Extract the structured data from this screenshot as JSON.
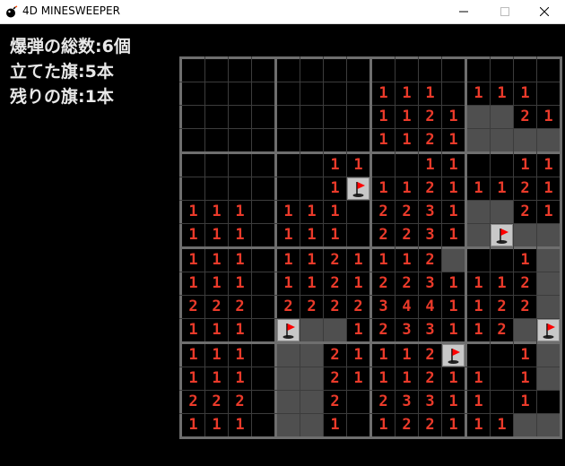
{
  "window": {
    "title": "4D MINESWEEPER",
    "minimize_glyph": "─",
    "maximize_glyph": "☐",
    "close_glyph": "✕"
  },
  "status": {
    "total_bombs": "爆弾の総数:6個",
    "flags_placed": "立てた旗:5本",
    "flags_left": "残りの旗:1本"
  },
  "colors": {
    "number": "#ea3a2a",
    "unopened": "#4f4f4f",
    "flag_cell": "#c8c8c8",
    "flag": "#ff0000"
  },
  "board": {
    "block_count": 4,
    "block_size": 4,
    "legend": "#=unopened, F=flag, -=opened empty, digits=count",
    "rows": [
      "----------------",
      "--------111-111-",
      "--------1121##21",
      "--------1121####",
      "------11--11--11",
      "------1F11211121",
      "111-111-2231##21",
      "111-111-2231#F##",
      "111-1121112#--1#",
      "111-11212231112#",
      "222-22223441122#",
      "111-F##1233112#F",
      "111-##21112F--1#",
      "111-##2111211-1#",
      "222-##2-23311-1-",
      "111-##1-122111##"
    ]
  }
}
